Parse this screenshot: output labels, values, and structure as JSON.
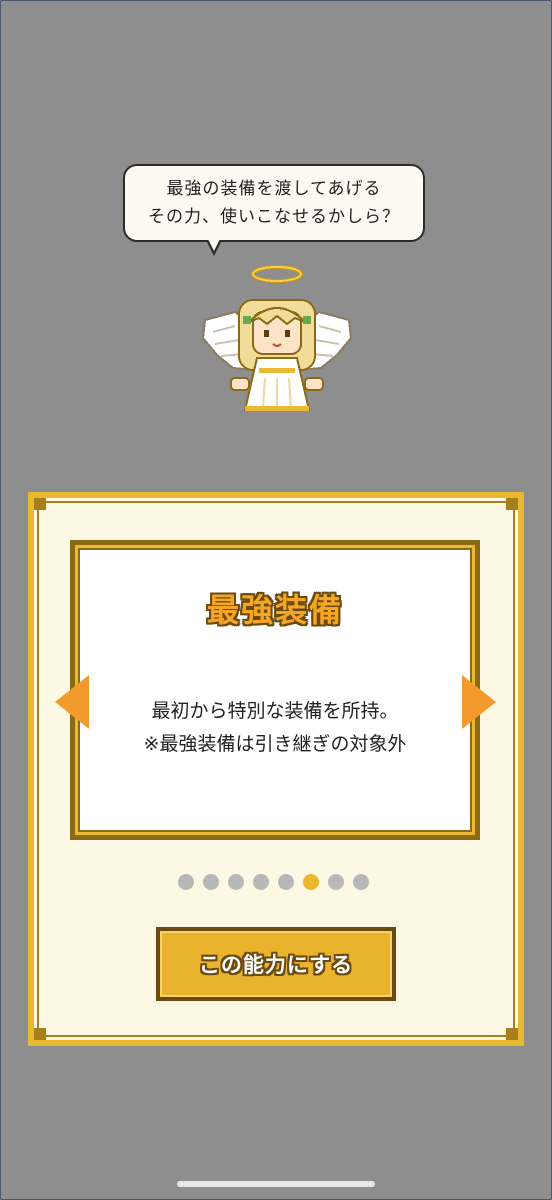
{
  "speech": {
    "line1": "最強の装備を渡してあげる",
    "line2": "その力、使いこなせるかしら？"
  },
  "ability": {
    "title": "最強装備",
    "desc_line1": "最初から特別な装備を所持。",
    "desc_line2": "※最強装備は引き継ぎの対象外"
  },
  "pager": {
    "count": 8,
    "active_index": 5
  },
  "select_button": {
    "label": "この能力にする"
  },
  "colors": {
    "background": "#8e8e8e",
    "card": "#fdf8e4",
    "gold": "#e8b931",
    "arrow": "#f29b2c",
    "dot_active": "#eab82a",
    "dot_inactive": "#b8b8b8"
  }
}
